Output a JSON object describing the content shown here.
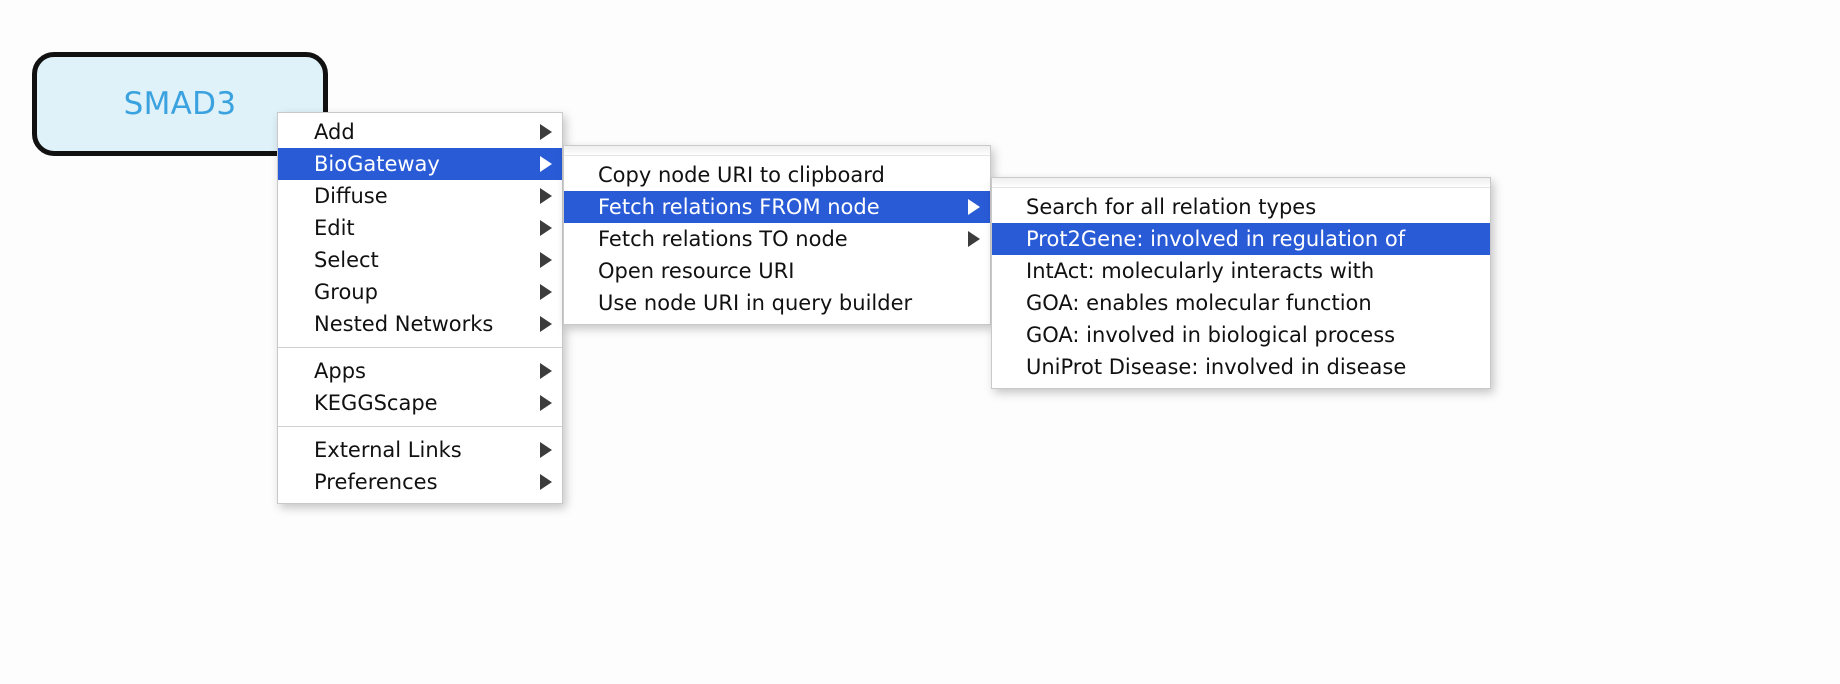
{
  "canvas": {
    "background_color": "#fdfdfd",
    "node": {
      "label": "SMAD3",
      "fill_color": "#dff1f9",
      "border_color": "#111111",
      "text_color": "#3ba2e0"
    }
  },
  "theme": {
    "menu_background": "#ffffff",
    "menu_border": "#c9c9c9",
    "highlight_color": "#2a5bd7",
    "highlight_text_color": "#ffffff",
    "text_color": "#111111",
    "separator_color": "#d2d2d2",
    "arrow_glyph": "triangle-right"
  },
  "menus": [
    {
      "id": "main",
      "name": "node-context-menu",
      "groups": [
        {
          "items": [
            {
              "label": "Add",
              "submenu": true,
              "selected": false
            },
            {
              "label": "BioGateway",
              "submenu": true,
              "selected": true
            },
            {
              "label": "Diffuse",
              "submenu": true,
              "selected": false
            },
            {
              "label": "Edit",
              "submenu": true,
              "selected": false
            },
            {
              "label": "Select",
              "submenu": true,
              "selected": false
            },
            {
              "label": "Group",
              "submenu": true,
              "selected": false
            },
            {
              "label": "Nested Networks",
              "submenu": true,
              "selected": false
            }
          ]
        },
        {
          "items": [
            {
              "label": "Apps",
              "submenu": true,
              "selected": false
            },
            {
              "label": "KEGGScape",
              "submenu": true,
              "selected": false
            }
          ]
        },
        {
          "items": [
            {
              "label": "External Links",
              "submenu": true,
              "selected": false
            },
            {
              "label": "Preferences",
              "submenu": true,
              "selected": false
            }
          ]
        }
      ]
    },
    {
      "id": "biogateway",
      "name": "biogateway-submenu",
      "groups": [
        {
          "items": [
            {
              "label": "Copy node URI to clipboard",
              "submenu": false,
              "selected": false
            },
            {
              "label": "Fetch relations FROM node",
              "submenu": true,
              "selected": true
            },
            {
              "label": "Fetch relations TO node",
              "submenu": true,
              "selected": false
            },
            {
              "label": "Open resource URI",
              "submenu": false,
              "selected": false
            },
            {
              "label": "Use node URI in query builder",
              "submenu": false,
              "selected": false
            }
          ]
        }
      ]
    },
    {
      "id": "fetch-from",
      "name": "fetch-relations-from-node-submenu",
      "groups": [
        {
          "items": [
            {
              "label": "Search for all relation types",
              "submenu": false,
              "selected": false
            },
            {
              "label": "Prot2Gene: involved in regulation of",
              "submenu": false,
              "selected": true
            },
            {
              "label": "IntAct: molecularly interacts with",
              "submenu": false,
              "selected": false
            },
            {
              "label": "GOA: enables molecular function",
              "submenu": false,
              "selected": false
            },
            {
              "label": "GOA: involved in biological process",
              "submenu": false,
              "selected": false
            },
            {
              "label": "UniProt Disease: involved in disease",
              "submenu": false,
              "selected": false
            }
          ]
        }
      ]
    }
  ]
}
